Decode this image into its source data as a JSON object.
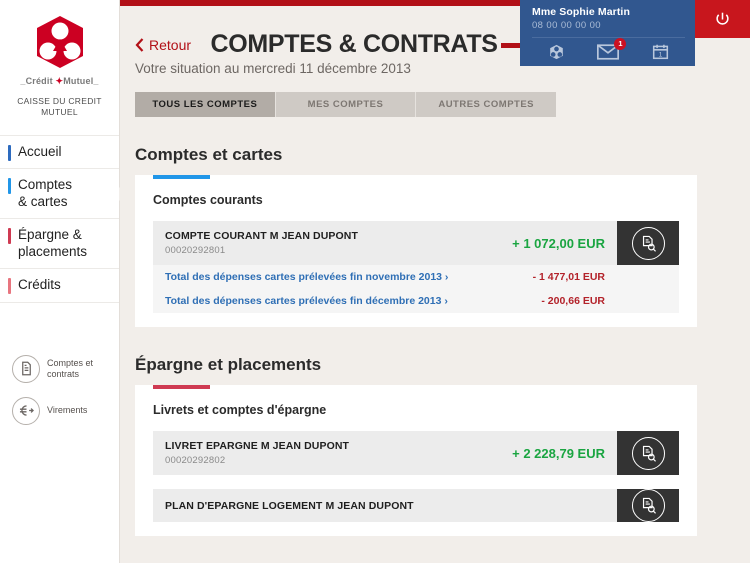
{
  "brand": {
    "wordmark_left": "Crédit",
    "wordmark_right": "Mutuel",
    "caisse_line1": "CAISSE DU CREDIT",
    "caisse_line2": "MUTUEL",
    "red": "#cc0022",
    "topbar_red": "#b21017"
  },
  "sidebar": {
    "items": [
      {
        "label": "Accueil",
        "bar_color": "#2d6bbf",
        "active": false
      },
      {
        "label": "Comptes\n& cartes",
        "bar_color": "#2196e8",
        "active": true
      },
      {
        "label": "Épargne &\nplacements",
        "bar_color": "#cf3a52",
        "active": false
      },
      {
        "label": "Crédits",
        "bar_color": "#e8757f",
        "active": false
      }
    ],
    "quick_links": [
      {
        "label": "Comptes et\ncontrats",
        "icon": "document-icon"
      },
      {
        "label": "Virements",
        "icon": "euro-transfer-icon"
      }
    ]
  },
  "user_panel": {
    "name": "Mme Sophie Martin",
    "phone": "08 00 00 00 00",
    "icons": [
      {
        "name": "credit-mutuel-logo-icon",
        "badge": null
      },
      {
        "name": "mail-icon",
        "badge": "1"
      },
      {
        "name": "calendar-icon",
        "badge": null,
        "day": "1"
      }
    ],
    "background": "#31578f"
  },
  "header": {
    "power_icon": "power-icon",
    "back_label": "Retour",
    "title": "COMPTES & CONTRATS",
    "subtitle": "Votre situation au mercredi 11 décembre 2013"
  },
  "tabs": [
    {
      "label": "TOUS LES COMPTES",
      "active": true
    },
    {
      "label": "MES COMPTES",
      "active": false
    },
    {
      "label": "AUTRES COMPTES",
      "active": false
    }
  ],
  "sections": [
    {
      "title": "Comptes et cartes",
      "card_heading": "Comptes courants",
      "accent_color": "#2196e8",
      "account": {
        "name": "COMPTE COURANT M JEAN DUPONT",
        "number": "00020292801",
        "amount": "+ 1 072,00 EUR",
        "amount_color": "#1aa541",
        "detail_icon": "document-search-icon"
      },
      "sub_rows": [
        {
          "label": "Total des dépenses cartes prélevées fin novembre 2013 ›",
          "amount": "- 1 477,01 EUR"
        },
        {
          "label": "Total des dépenses cartes prélevées fin décembre 2013 ›",
          "amount": "- 200,66 EUR"
        }
      ]
    },
    {
      "title": "Épargne et placements",
      "card_heading": "Livrets et comptes d'épargne",
      "accent_color": "#cf3a52",
      "account": {
        "name": "LIVRET EPARGNE M JEAN DUPONT",
        "number": "00020292802",
        "amount": "+ 2 228,79 EUR",
        "amount_color": "#1aa541",
        "detail_icon": "document-search-icon"
      },
      "sub_rows": [],
      "next_account": {
        "name": "PLAN D'EPARGNE LOGEMENT M JEAN DUPONT",
        "detail_icon": "document-search-icon"
      }
    }
  ]
}
